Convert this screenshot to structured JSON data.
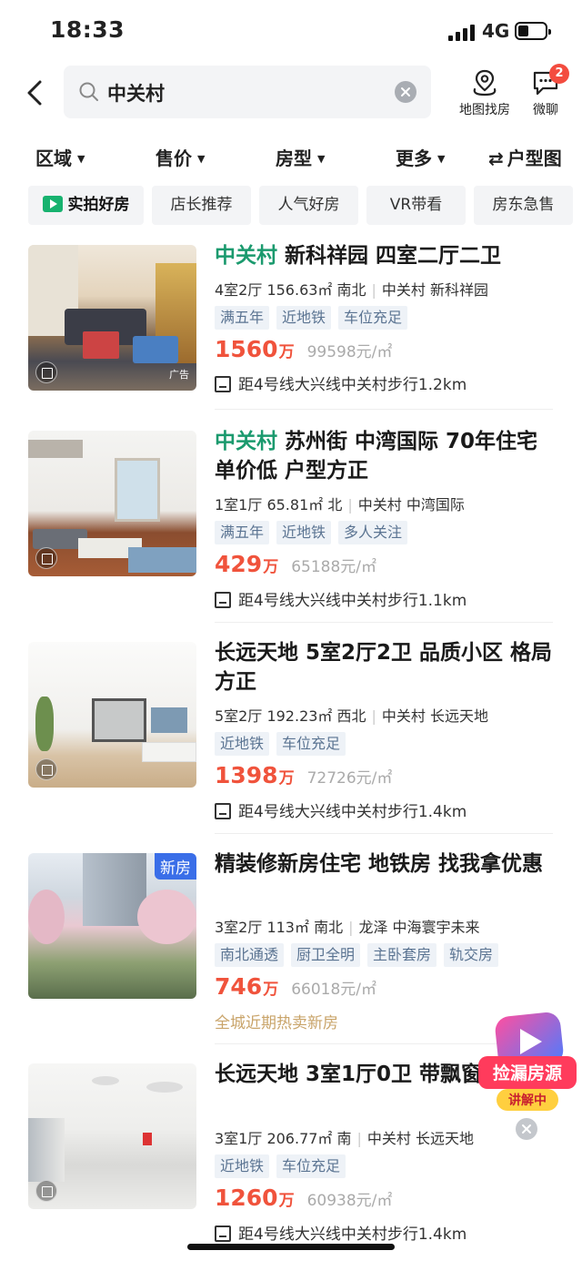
{
  "status": {
    "time": "18:33",
    "network": "4G",
    "battery_level": 0.35
  },
  "header": {
    "query": "中关村",
    "map_label": "地图找房",
    "chat_label": "微聊",
    "chat_badge": "2"
  },
  "filters": [
    {
      "label": "区域",
      "caret": "▼"
    },
    {
      "label": "售价",
      "caret": "▼"
    },
    {
      "label": "房型",
      "caret": "▼"
    },
    {
      "label": "更多",
      "caret": "▼"
    },
    {
      "label": "户型图",
      "icon": "⇄"
    }
  ],
  "chips": [
    "实拍好房",
    "店长推荐",
    "人气好房",
    "VR带看",
    "房东急售"
  ],
  "listings": [
    {
      "title_hl": "中关村",
      "title": " 新科祥园 四室二厅二卫",
      "meta": [
        "4室2厅 156.63㎡ 南北",
        "中关村 新科祥园"
      ],
      "tags": [
        "满五年",
        "近地铁",
        "车位充足"
      ],
      "price": "1560",
      "price_unit": "万",
      "per": "99598元/㎡",
      "subway": "距4号线大兴线中关村步行1.2km",
      "ad": "广告"
    },
    {
      "title_hl": "中关村",
      "title": " 苏州街 中湾国际  70年住宅 单价低 户型方正",
      "meta": [
        "1室1厅 65.81㎡ 北",
        "中关村 中湾国际"
      ],
      "tags": [
        "满五年",
        "近地铁",
        "多人关注"
      ],
      "price": "429",
      "price_unit": "万",
      "per": "65188元/㎡",
      "subway": "距4号线大兴线中关村步行1.1km"
    },
    {
      "title_hl": "",
      "title": "长远天地 5室2厅2卫 品质小区 格局方正",
      "meta": [
        "5室2厅 192.23㎡ 西北",
        "中关村 长远天地"
      ],
      "tags": [
        "近地铁",
        "车位充足"
      ],
      "price": "1398",
      "price_unit": "万",
      "per": "72726元/㎡",
      "subway": "距4号线大兴线中关村步行1.4km"
    },
    {
      "title_hl": "",
      "title": "精装修新房住宅 地铁房 找我拿优惠",
      "meta": [
        "3室2厅 113㎡ 南北",
        "龙泽 中海寰宇未来"
      ],
      "tags": [
        "南北通透",
        "厨卫全明",
        "主卧套房",
        "轨交房"
      ],
      "price": "746",
      "price_unit": "万",
      "per": "66018元/㎡",
      "hot": "全城近期热卖新房",
      "newtag": "新房"
    },
    {
      "title_hl": "",
      "title": "长远天地 3室1厅0卫 带飘窗 南户型",
      "meta": [
        "3室1厅 206.77㎡ 南",
        "中关村 长远天地"
      ],
      "tags": [
        "近地铁",
        "车位充足"
      ],
      "price": "1260",
      "price_unit": "万",
      "per": "60938元/㎡",
      "subway": "距4号线大兴线中关村步行1.4km"
    }
  ],
  "promo": {
    "line1": "捡漏房源",
    "line2": "讲解中"
  },
  "colors": {
    "accent_green": "#1b9a6e",
    "price_red": "#f0533c",
    "tag_blue": "#5b7492",
    "badge_red": "#f34c3f"
  }
}
